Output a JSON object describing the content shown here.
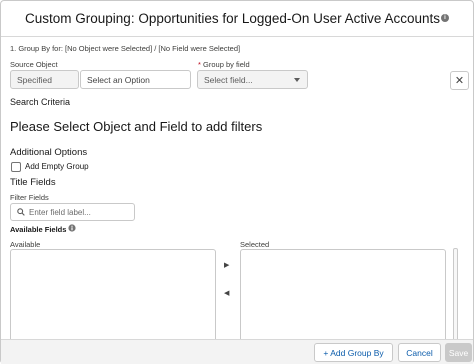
{
  "modal": {
    "title": "Custom Grouping: Opportunities for Logged-On User Active Accounts",
    "info_icon": "i"
  },
  "group_by": {
    "heading": "1. Group By for: [No Object were Selected] / [No Field were Selected]",
    "source_object_label": "Source Object",
    "source_object_type": "Specified",
    "source_object_placeholder": "Select an Option",
    "group_by_field_required": "*",
    "group_by_field_label": "Group by field",
    "group_by_field_placeholder": "Select field...",
    "remove_icon": "✕"
  },
  "search_criteria": {
    "heading": "Search Criteria",
    "message": "Please Select Object and Field to add filters"
  },
  "additional_options": {
    "heading": "Additional Options",
    "add_empty_group_label": "Add Empty Group",
    "add_empty_group_checked": false
  },
  "title_fields": {
    "heading": "Title Fields",
    "filter_label": "Filter Fields",
    "filter_placeholder": "Enter field label...",
    "available_fields_label": "Available Fields",
    "available_label": "Available",
    "selected_label": "Selected",
    "move_right_icon": "▶",
    "move_left_icon": "◀"
  },
  "footer": {
    "add_group_by_label": "+ Add Group By",
    "cancel_label": "Cancel",
    "save_label": "Save"
  },
  "colors": {
    "brand_blue": "#0b5cab",
    "border": "#c9c9c9",
    "footer_bg": "#f3f3f3",
    "disabled_btn": "#c9c9c9"
  }
}
